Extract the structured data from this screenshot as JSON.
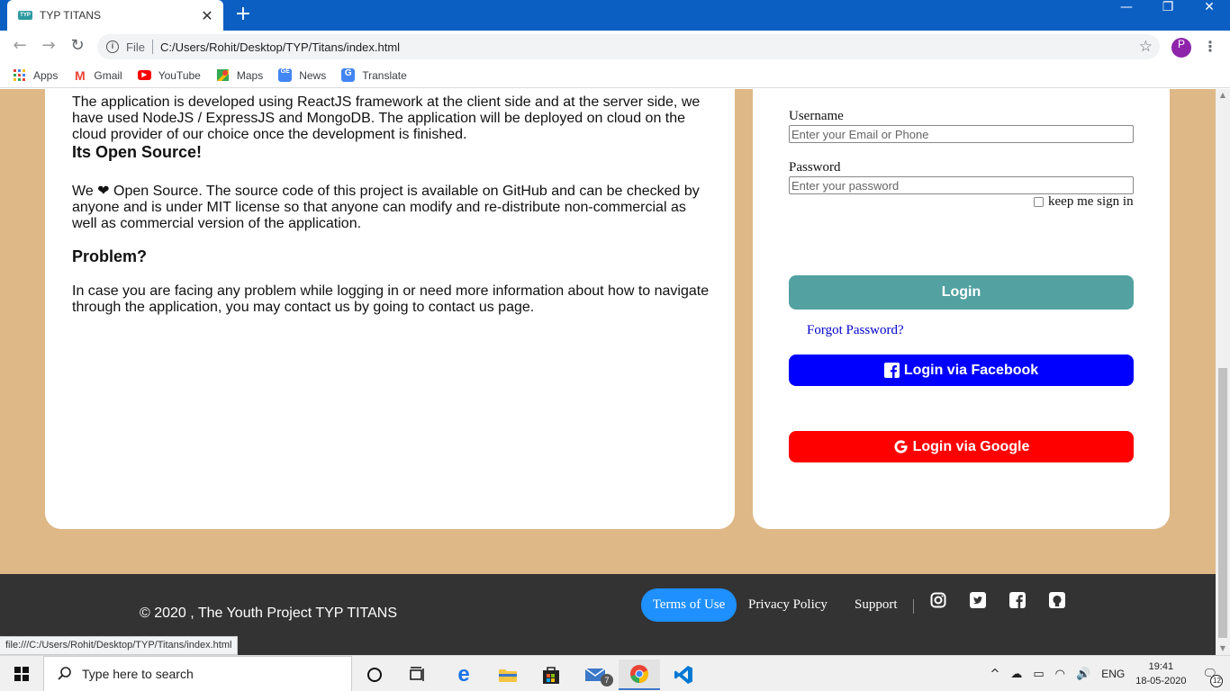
{
  "browser": {
    "tab_title": "TYP TITANS",
    "new_tab_symbol": "+",
    "address_prefix": "File",
    "url": "C:/Users/Rohit/Desktop/TYP/Titans/index.html",
    "profile_initial": "P",
    "bookmarks": [
      {
        "label": "Apps",
        "icon": "apps-grid-icon"
      },
      {
        "label": "Gmail",
        "icon": "gmail-icon"
      },
      {
        "label": "YouTube",
        "icon": "youtube-icon"
      },
      {
        "label": "Maps",
        "icon": "maps-icon"
      },
      {
        "label": "News",
        "icon": "news-icon"
      },
      {
        "label": "Translate",
        "icon": "translate-icon"
      }
    ],
    "status_link": "file:///C:/Users/Rohit/Desktop/TYP/Titans/index.html"
  },
  "about": {
    "intro_text": "The application is developed using ReactJS framework at the client side and at the server side, we have used NodeJS / ExpressJS and MongoDB. The application will be deployed on cloud on the cloud provider of our choice once the development is finished.",
    "open_source_heading": "Its Open Source!",
    "open_source_pre": "We",
    "open_source_text": "Open Source. The source code of this project is available on GitHub and can be checked by anyone and is under MIT license so that anyone can modify and re-distribute non-commercial as well as commercial version of the application.",
    "problem_heading": "Problem?",
    "problem_text": "In case you are facing any problem while logging in or need more information about how to navigate through the application, you may contact us by going to contact us page."
  },
  "login": {
    "username_label": "Username",
    "username_placeholder": "Enter your Email or Phone",
    "password_label": "Password",
    "password_placeholder": "Enter your password",
    "keep_signed_in": "keep me sign in",
    "login_button": "Login",
    "forgot_password": "Forgot Password?",
    "facebook_button": "Login via Facebook",
    "google_button": "Login via Google"
  },
  "footer": {
    "copyright": "© 2020 , The Youth Project TYP TITANS",
    "links": [
      "Terms of Use",
      "Privacy Policy",
      "Support"
    ],
    "social_icons": [
      "instagram-icon",
      "twitter-icon",
      "facebook-icon",
      "github-icon"
    ]
  },
  "taskbar": {
    "search_placeholder": "Type here to search",
    "mail_badge": "7",
    "language": "ENG",
    "time": "19:41",
    "date": "18-05-2020",
    "notification_count": "12"
  },
  "colors": {
    "page_background": "#deb887",
    "login_button": "#53a1a1",
    "facebook_button": "#0000ff",
    "google_button": "#ff0000",
    "footer": "#333333",
    "terms_pill": "#1e90ff",
    "browser_frame": "#0b5fc2"
  }
}
